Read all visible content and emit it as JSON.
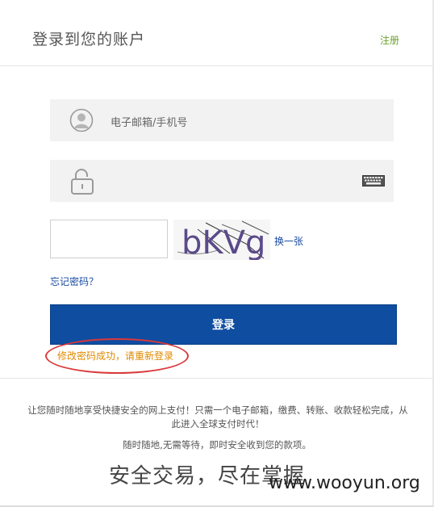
{
  "header": {
    "title": "登录到您的账户",
    "register_link": "注册"
  },
  "form": {
    "username": {
      "placeholder": "电子邮箱/手机号",
      "value": ""
    },
    "password": {
      "value": ""
    },
    "captcha": {
      "input_value": "",
      "image_text": "bKVg",
      "refresh_link": "换一张"
    },
    "forgot_link": "忘记密码？",
    "login_button": "登录",
    "status_message": "修改密码成功，请重新登录"
  },
  "footer": {
    "description": "让您随时随地享受快捷安全的网上支付！只需一个电子邮箱，缴费、转账、收款轻松完成，从此进入全球支付时代！",
    "note": "随时随地,无需等待，即时安全收到您的款项。",
    "slogan": "安全交易，尽在掌握"
  },
  "watermark": "www.wooyun.org",
  "colors": {
    "primary_button": "#0f4da1",
    "register_link": "#6aa12a",
    "link": "#1a4ba0",
    "status_message": "#e08a00",
    "highlight_oval": "#d9383a"
  },
  "icons": {
    "username": "user-icon",
    "password": "lock-icon",
    "soft_keyboard": "keyboard-icon"
  }
}
